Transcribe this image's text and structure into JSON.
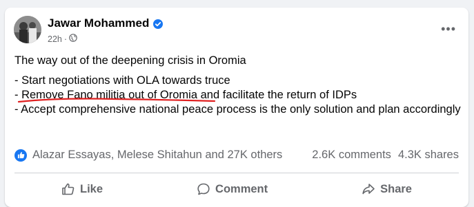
{
  "post": {
    "author": "Jawar Mohammed",
    "timestamp": "22h",
    "privacy_icon": "globe-icon",
    "verified_icon": "verified-badge-icon",
    "more_icon": "more-icon",
    "more_label": "•••"
  },
  "content": {
    "title": "The way out of the deepening crisis in Oromia",
    "line1": "- Start negotiations with OLA towards truce",
    "line2_prefix": "- ",
    "line2_highlight": "Remove Fano militia out of Oromia",
    "line2_rest": " and facilitate the return of IDPs",
    "line3": "- Accept comprehensive national peace process is the only solution and plan accordingly"
  },
  "reactions": {
    "names": "Alazar Essayas, Melese Shitahun and 27K others",
    "comments": "2.6K comments",
    "shares": "4.3K shares"
  },
  "actions": {
    "like": "Like",
    "comment": "Comment",
    "share": "Share"
  },
  "colors": {
    "brand_blue": "#1877f2",
    "highlight_red": "#e02020",
    "secondary_text": "#65676b"
  }
}
